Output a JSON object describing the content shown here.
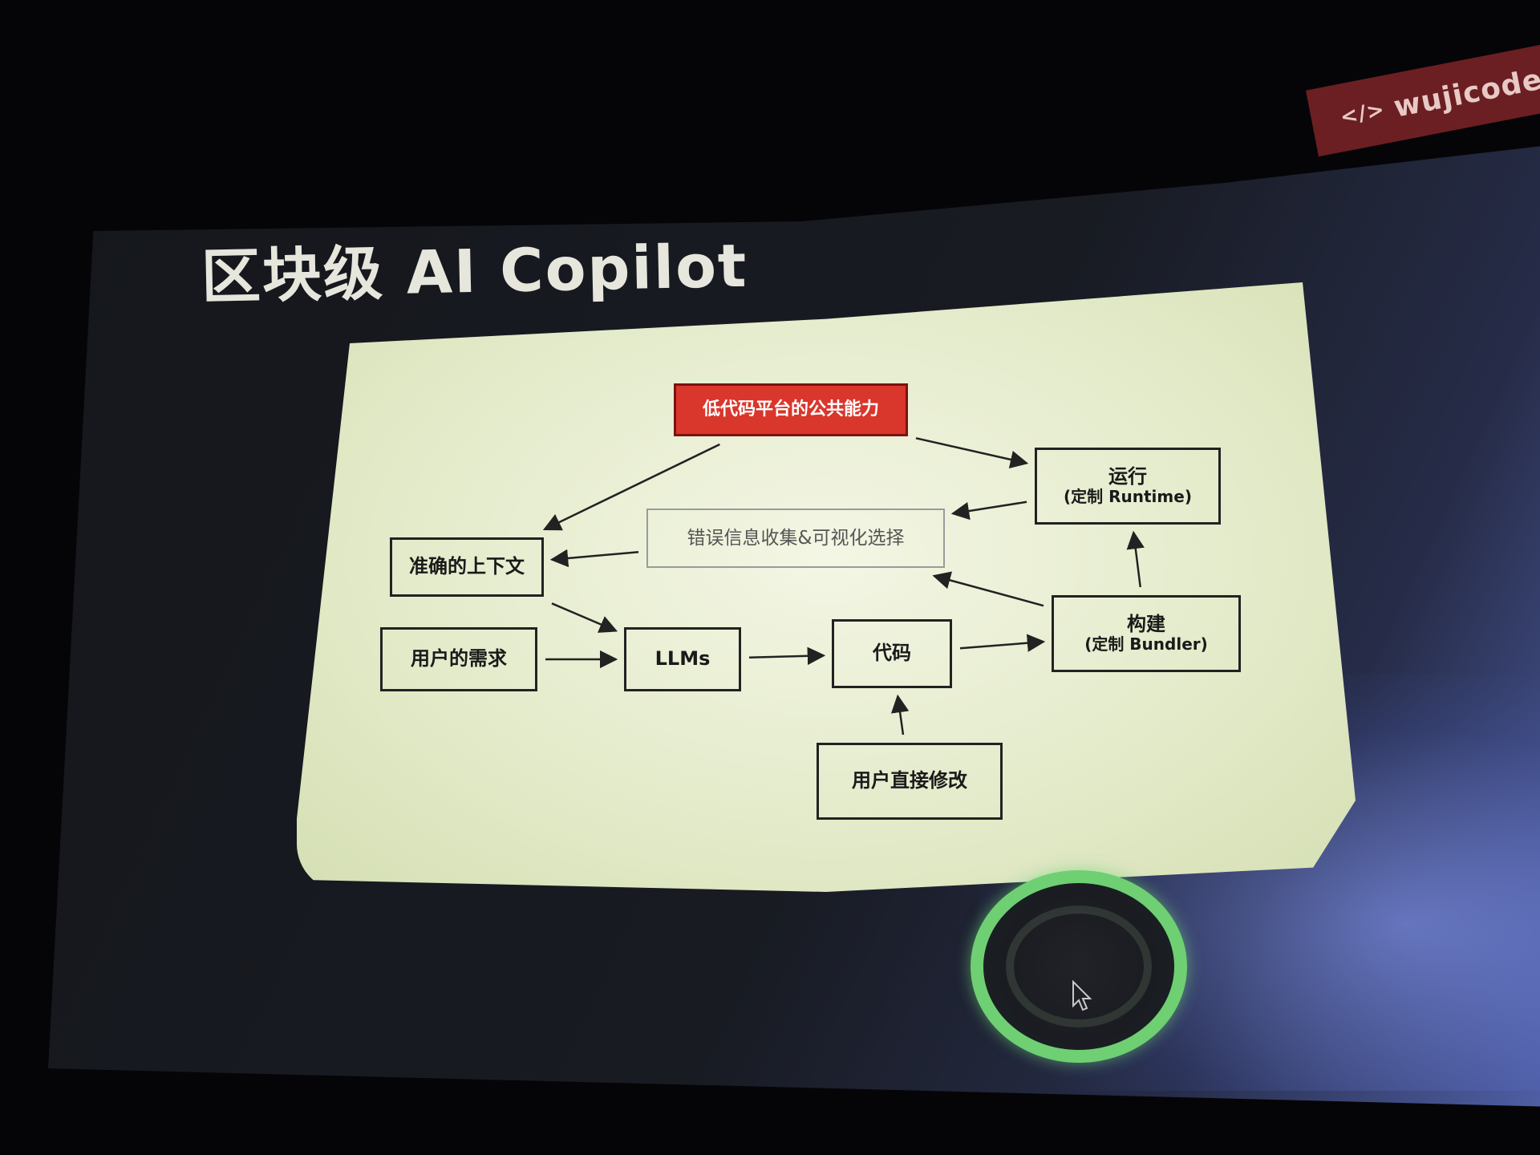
{
  "site_badge": {
    "code_symbol": "</>",
    "text": "wujicode.c"
  },
  "title": "区块级 AI Copilot",
  "nodes": {
    "platform": "低代码平台的公共能力",
    "runtime": {
      "title": "运行",
      "sub": "(定制 Runtime)"
    },
    "error": "错误信息收集&可视化选择",
    "context": "准确的上下文",
    "demand": "用户的需求",
    "llms": "LLMs",
    "code": "代码",
    "build": {
      "title": "构建",
      "sub": "(定制 Bundler)"
    },
    "edit": "用户直接修改"
  },
  "edges": [
    {
      "from": "platform",
      "to": "runtime"
    },
    {
      "from": "platform",
      "to": "context"
    },
    {
      "from": "runtime",
      "to": "error"
    },
    {
      "from": "error",
      "to": "context"
    },
    {
      "from": "context",
      "to": "llms"
    },
    {
      "from": "demand",
      "to": "llms"
    },
    {
      "from": "llms",
      "to": "code"
    },
    {
      "from": "code",
      "to": "build"
    },
    {
      "from": "build",
      "to": "runtime"
    },
    {
      "from": "build",
      "to": "error"
    },
    {
      "from": "edit",
      "to": "code"
    }
  ],
  "colors": {
    "platform_fill": "#d9362c",
    "panel": "#e4ebcb",
    "badge": "#6b1f22",
    "cursor_ring": "#6fcf73"
  },
  "icons": {
    "badge": "code-brackets-icon",
    "cursor": "mouse-pointer-icon"
  }
}
